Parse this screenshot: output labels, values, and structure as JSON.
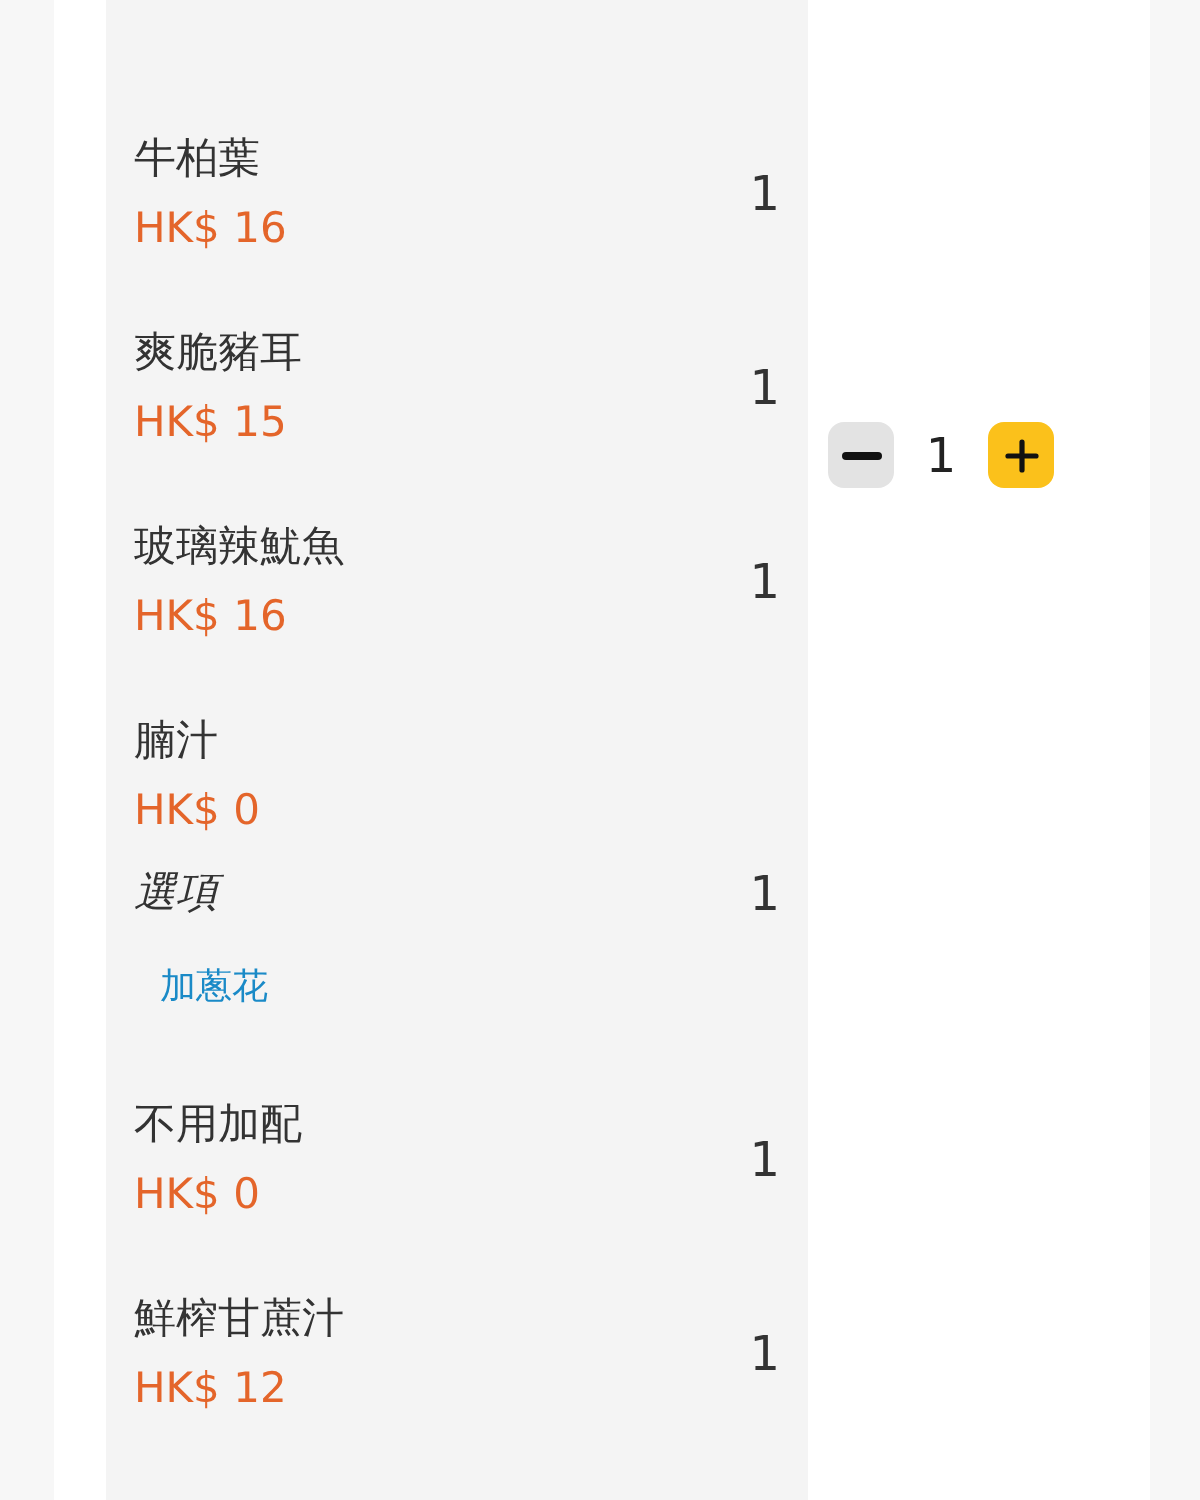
{
  "items": [
    {
      "name": "牛柏葉",
      "price": "HK$ 16",
      "quantity": "1"
    },
    {
      "name": "爽脆豬耳",
      "price": "HK$ 15",
      "quantity": "1"
    },
    {
      "name": "玻璃辣魷魚",
      "price": "HK$ 16",
      "quantity": "1"
    },
    {
      "name": "腩汁",
      "price": "HK$ 0",
      "quantity": "1",
      "options_label": "選項",
      "options": [
        "加蔥花"
      ]
    },
    {
      "name": "不用加配",
      "price": "HK$ 0",
      "quantity": "1"
    },
    {
      "name": "鮮榨甘蔗汁",
      "price": "HK$ 12",
      "quantity": "1"
    }
  ],
  "stepper": {
    "value": "1"
  }
}
